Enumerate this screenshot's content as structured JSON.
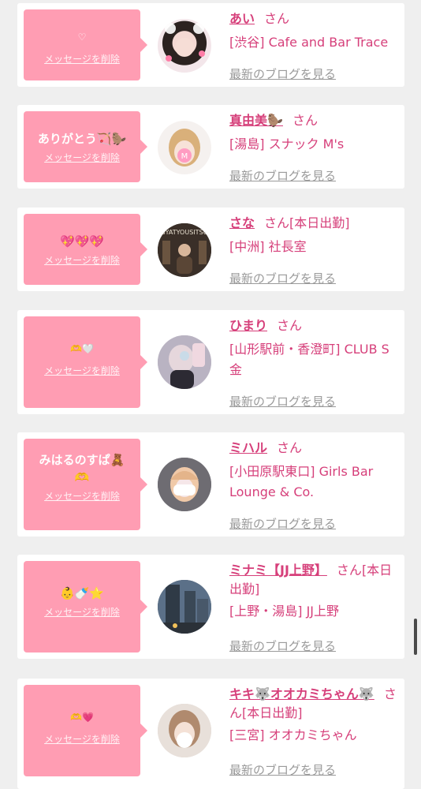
{
  "delete_label": "メッセージを削除",
  "san_label": "さん",
  "blog_label": "最新のブログを見る",
  "colors": {
    "page_bg": "#efefef",
    "bubble": "#ff9db3",
    "accent": "#d63f7a",
    "link_gray": "#9a9a9a"
  },
  "cards": [
    {
      "message": "♡",
      "name": "あい",
      "status": "",
      "shop": "[渋谷] Cafe and Bar Trace"
    },
    {
      "message": "ありがとう🏹🦫",
      "name": "真由美🦫",
      "status": "",
      "shop": "[湯島] スナック M's"
    },
    {
      "message": "💖💖💖",
      "name": "さな",
      "status": "[本日出勤]",
      "shop": "[中洲] 社長室"
    },
    {
      "message": "🫶🤍",
      "name": "ひまり",
      "status": "",
      "shop": "[山形駅前・香澄町] CLUB S金"
    },
    {
      "message": "みはるのすぱ🧸\n🫶",
      "name": "ミハル",
      "status": "",
      "shop": "[小田原駅東口] Girls Bar Lounge & Co."
    },
    {
      "message": "👶🍼⭐",
      "name": "ミナミ【JJ上野】",
      "status": "[本日出勤]",
      "shop": "[上野・湯島] JJ上野"
    },
    {
      "message": "🫶💗",
      "name": "キキ🐺オオカミちゃん🐺",
      "status": "[本日出勤]",
      "shop": "[三宮] オオカミちゃん"
    }
  ]
}
